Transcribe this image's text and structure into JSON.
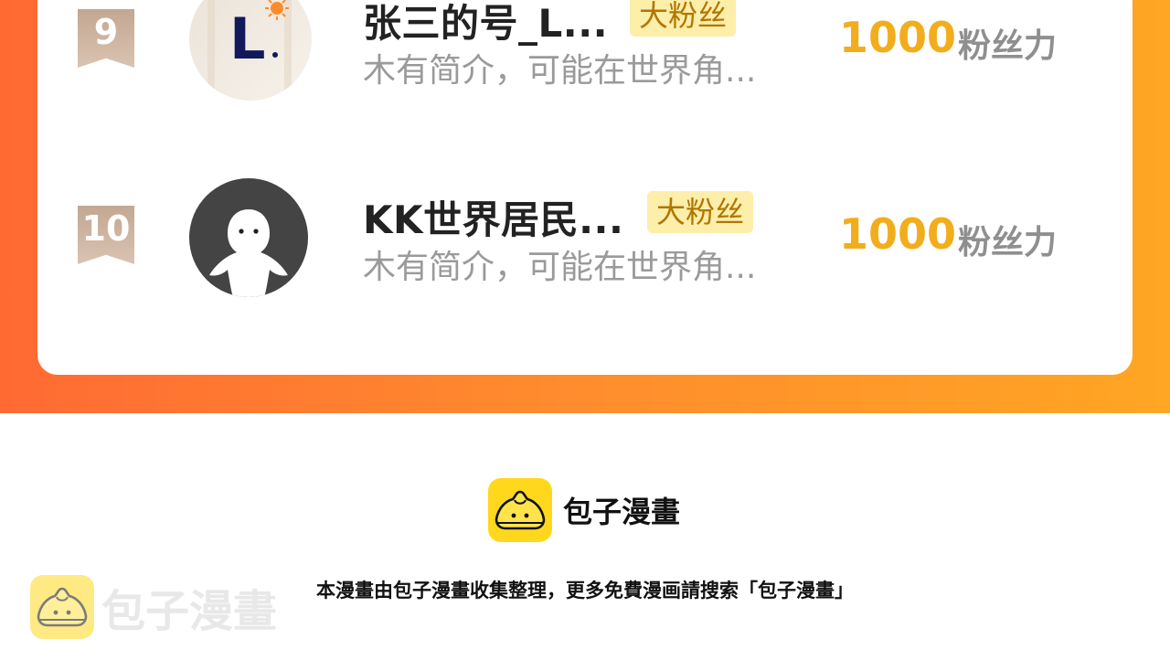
{
  "ranking": {
    "rows": [
      {
        "rank": "9",
        "name": "张三的号_L...",
        "badge": "大粉丝",
        "bio": "木有简介，可能在世界角...",
        "power_value": "1000",
        "power_label": "粉丝力",
        "avatar_icon": "letter-l-avatar"
      },
      {
        "rank": "10",
        "name": "KK世界居民...",
        "badge": "大粉丝",
        "bio": "木有简介，可能在世界角...",
        "power_value": "1000",
        "power_label": "粉丝力",
        "avatar_icon": "default-ghost-avatar"
      }
    ]
  },
  "footer": {
    "brand_name": "包子漫畫",
    "notice": "本漫畫由包子漫畫收集整理，更多免費漫画請搜索「包子漫畫」",
    "watermark_text": "包子漫畫"
  },
  "colors": {
    "gradient_start": "#ff6a33",
    "gradient_end": "#ffa623",
    "power": "#f2ad1c",
    "badge_bg": "#fdeeaa",
    "brand_yellow": "#ffd81d"
  }
}
